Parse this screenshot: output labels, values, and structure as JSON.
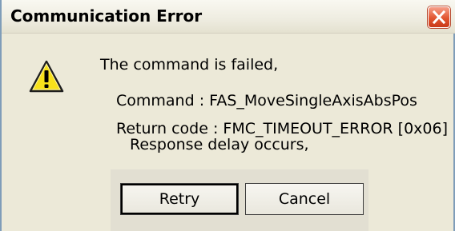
{
  "window": {
    "title": "Communication Error"
  },
  "message": {
    "line1": "The command is failed,",
    "line2": "Command : FAS_MoveSingleAxisAbsPos",
    "line3": "Return code : FMC_TIMEOUT_ERROR [0x06]",
    "line4": "Response delay occurs,"
  },
  "buttons": {
    "retry": "Retry",
    "cancel": "Cancel"
  },
  "icons": {
    "warning": "warning-icon",
    "close": "close-icon"
  },
  "colors": {
    "close_button": "#E25530",
    "warning_fill": "#F7E11B"
  }
}
